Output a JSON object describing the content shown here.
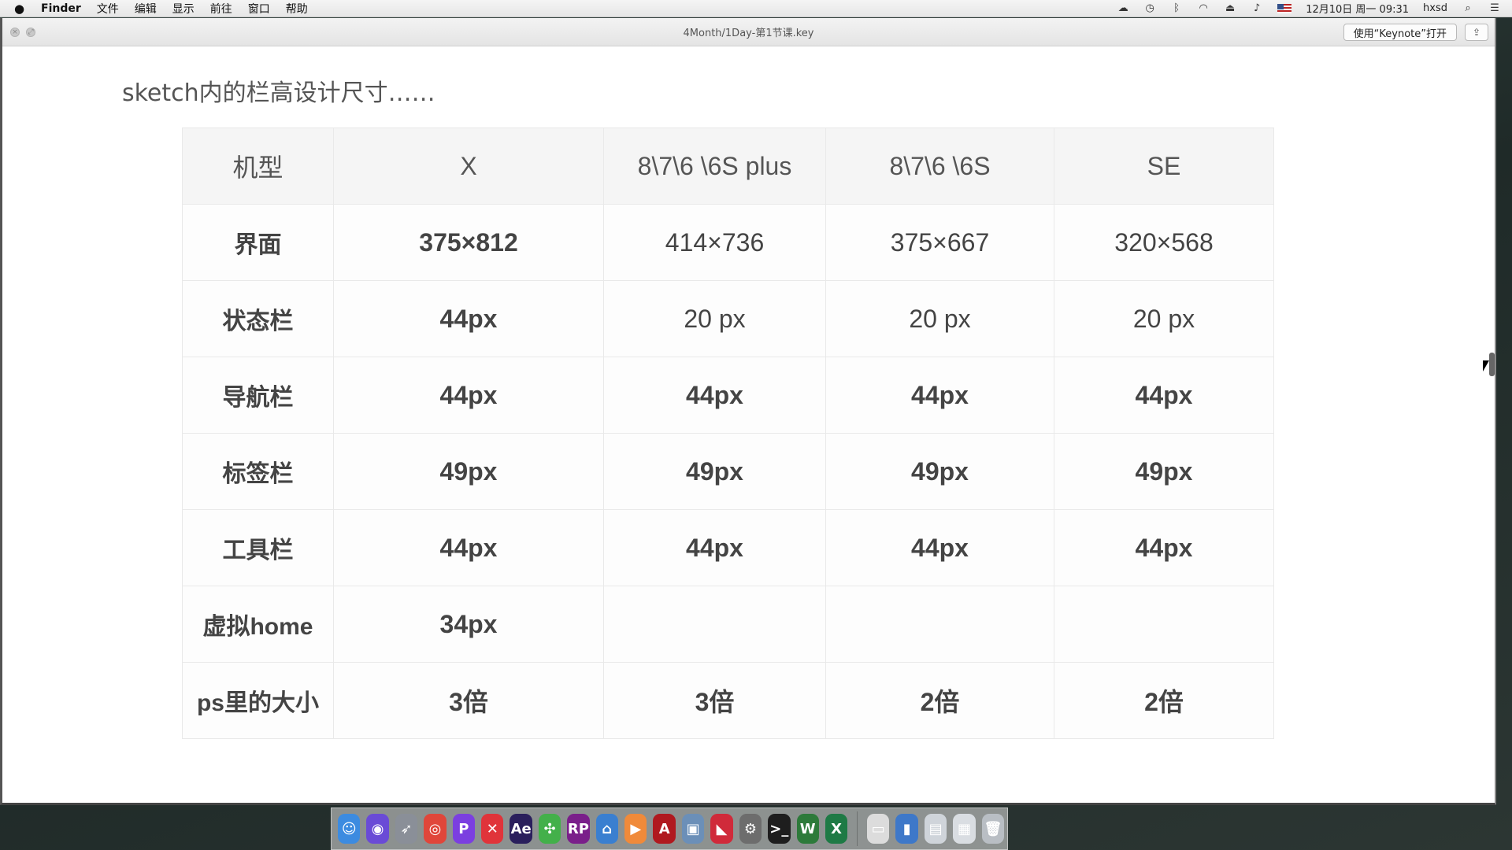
{
  "menubar": {
    "items": [
      "Finder",
      "文件",
      "编辑",
      "显示",
      "前往",
      "窗口",
      "帮助"
    ],
    "status_icons": [
      "creative-cloud-icon",
      "time-machine-icon",
      "bluetooth-icon",
      "wifi-icon",
      "eject-icon",
      "volume-icon"
    ],
    "datetime": "12月10日 周一 09:31",
    "user": "hxsd"
  },
  "window": {
    "title": "4Month/1Day-第1节课.key",
    "open_button": "使用“Keynote”打开"
  },
  "slide": {
    "title": "sketch内的栏高设计尺寸……",
    "table": {
      "headers": [
        "机型",
        "X",
        "8\\7\\6 \\6S plus",
        "8\\7\\6 \\6S",
        "SE"
      ],
      "rows": [
        {
          "label": "界面",
          "cells": [
            "375×812",
            "414×736",
            "375×667",
            "320×568"
          ]
        },
        {
          "label": "状态栏",
          "cells": [
            "44px",
            "20 px",
            "20 px",
            "20 px"
          ]
        },
        {
          "label": "导航栏",
          "cells": [
            "44px",
            "44px",
            "44px",
            "44px"
          ]
        },
        {
          "label": "标签栏",
          "cells": [
            "49px",
            "49px",
            "49px",
            "49px"
          ]
        },
        {
          "label": "工具栏",
          "cells": [
            "44px",
            "44px",
            "44px",
            "44px"
          ]
        },
        {
          "label": "虚拟home",
          "cells": [
            "34px",
            "",
            "",
            ""
          ]
        },
        {
          "label": "ps里的大小",
          "cells": [
            "3倍",
            "3倍",
            "2倍",
            "2倍"
          ]
        }
      ]
    }
  },
  "dock": {
    "apps": [
      {
        "name": "finder-icon",
        "glyph": "☺",
        "color": "#3c8be0"
      },
      {
        "name": "siri-icon",
        "glyph": "◉",
        "color": "#6a4bd6"
      },
      {
        "name": "launchpad-icon",
        "glyph": "➶",
        "color": "#8a8f98"
      },
      {
        "name": "chrome-icon",
        "glyph": "◎",
        "color": "#e0463a"
      },
      {
        "name": "pockity-icon",
        "glyph": "P",
        "color": "#7b3fe0"
      },
      {
        "name": "xmind-icon",
        "glyph": "✕",
        "color": "#e0343a"
      },
      {
        "name": "after-effects-icon",
        "glyph": "Ae",
        "color": "#2a1f5c"
      },
      {
        "name": "mindnode-icon",
        "glyph": "✣",
        "color": "#43b04a"
      },
      {
        "name": "axure-icon",
        "glyph": "RP",
        "color": "#7a1f8a"
      },
      {
        "name": "keynote-icon",
        "glyph": "⌂",
        "color": "#3a7fd0"
      },
      {
        "name": "infuse-icon",
        "glyph": "▶",
        "color": "#f08a3a"
      },
      {
        "name": "acrobat-icon",
        "glyph": "A",
        "color": "#b0191f"
      },
      {
        "name": "preview-icon",
        "glyph": "▣",
        "color": "#6b8fb8"
      },
      {
        "name": "sketch-alt-icon",
        "glyph": "◣",
        "color": "#d02a3a"
      },
      {
        "name": "system-preferences-icon",
        "glyph": "⚙",
        "color": "#6d6d6d"
      },
      {
        "name": "terminal-icon",
        "glyph": ">_",
        "color": "#1e1e1e"
      },
      {
        "name": "vectorize-icon",
        "glyph": "W",
        "color": "#2d7a3a"
      },
      {
        "name": "excel-icon",
        "glyph": "X",
        "color": "#1e7a45"
      }
    ],
    "stack": [
      {
        "name": "blank-window-icon",
        "glyph": "▭",
        "color": "#dcdcdc"
      },
      {
        "name": "downloads-folder-icon",
        "glyph": "▮",
        "color": "#3e78c9"
      },
      {
        "name": "document-stack-icon",
        "glyph": "▤",
        "color": "#cfd4da"
      },
      {
        "name": "browser-window-icon",
        "glyph": "▦",
        "color": "#d9dde2"
      },
      {
        "name": "trash-icon",
        "glyph": "🗑",
        "color": "#b9bec4"
      }
    ]
  }
}
